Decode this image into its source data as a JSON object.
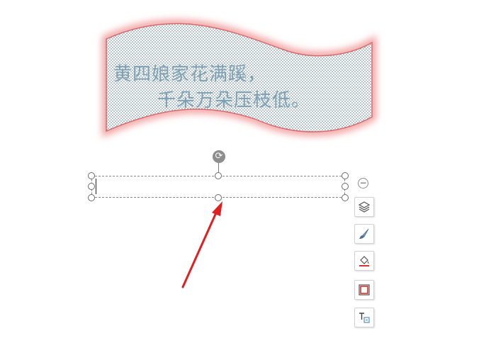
{
  "banner": {
    "line1": "黄四娘家花满蹊，",
    "line2": "千朵万朵压枝低。"
  },
  "textbox": {
    "value": ""
  },
  "toolbar": {
    "items": [
      {
        "icon": "layers-icon"
      },
      {
        "icon": "brush-icon"
      },
      {
        "icon": "fill-bucket-icon"
      },
      {
        "icon": "outline-icon"
      },
      {
        "icon": "text-box-icon"
      }
    ]
  },
  "colors": {
    "banner_glow": "#f3a2a2",
    "banner_outline": "#d86a6a",
    "banner_text": "#7f9fb5",
    "pattern_dot": "#5f7f96",
    "arrow": "#e02020",
    "fill_underline": "#d9342b"
  }
}
